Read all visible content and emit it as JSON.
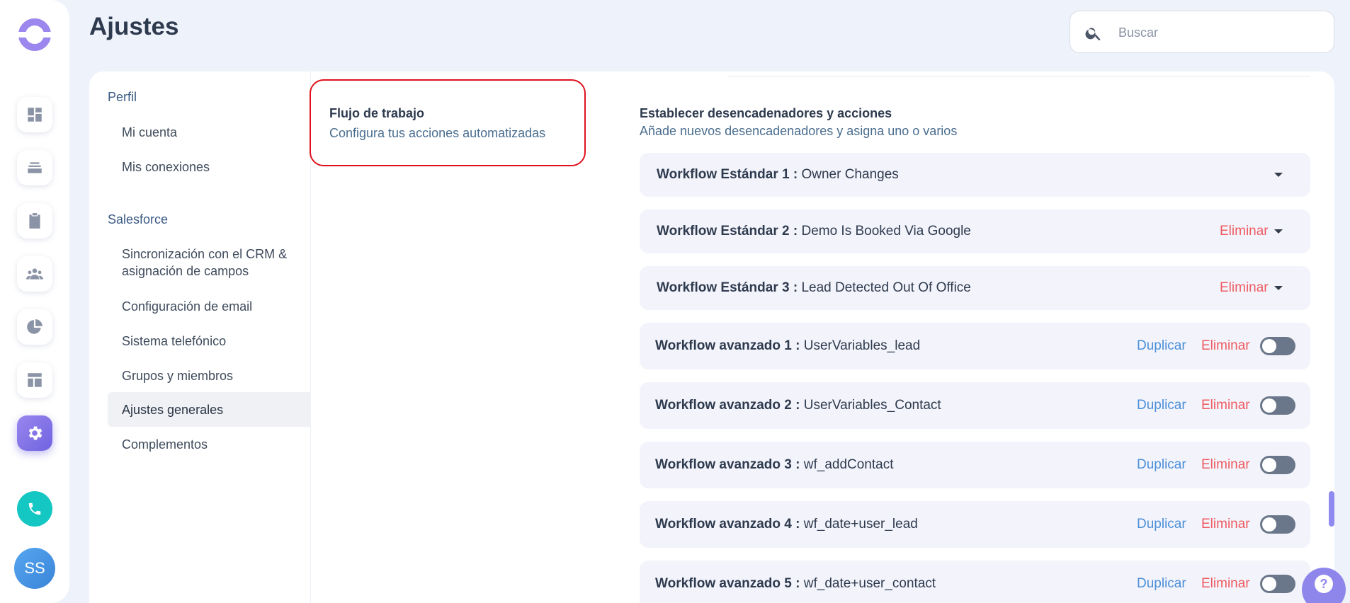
{
  "header": {
    "title": "Ajustes"
  },
  "search": {
    "placeholder": "Buscar"
  },
  "avatar": {
    "initials": "SS"
  },
  "help": {
    "glyph": "?"
  },
  "colors": {
    "accent": "#6f63e0",
    "danger": "#ee5a61",
    "link": "#4a8ed8",
    "highlight_border": "#e0111c"
  },
  "rail": {
    "items": [
      {
        "icon": "dashboard-icon",
        "active": false
      },
      {
        "icon": "inbox-icon",
        "active": false
      },
      {
        "icon": "clipboard-icon",
        "active": false
      },
      {
        "icon": "people-icon",
        "active": false
      },
      {
        "icon": "pie-chart-icon",
        "active": false
      },
      {
        "icon": "layout-icon",
        "active": false
      },
      {
        "icon": "gear-icon",
        "active": true
      }
    ]
  },
  "sidebar": {
    "sections": [
      {
        "heading": "Perfil",
        "items": [
          "Mi cuenta",
          "Mis conexiones"
        ]
      },
      {
        "heading": "Salesforce",
        "items": [
          "Sincronización con el CRM & asignación de campos",
          "Configuración de email",
          "Sistema telefónico",
          "Grupos y miembros",
          "Ajustes generales",
          "Complementos"
        ]
      }
    ],
    "active_item": "Ajustes generales"
  },
  "workflow_section": {
    "title": "Flujo de trabajo",
    "subtitle": "Configura tus acciones automatizadas"
  },
  "triggers": {
    "title": "Establecer desencadenadores y acciones",
    "subtitle": "Añade nuevos desencadenadores y asigna uno o varios"
  },
  "actions": {
    "duplicate": "Duplicar",
    "delete": "Eliminar"
  },
  "workflows": [
    {
      "prefix": "Workflow Estándar 1 :",
      "name": "Owner Changes",
      "type": "standard",
      "deletable": false
    },
    {
      "prefix": "Workflow Estándar 2 :",
      "name": "Demo Is Booked Via Google",
      "type": "standard",
      "deletable": true
    },
    {
      "prefix": "Workflow Estándar 3 :",
      "name": "Lead Detected Out Of Office",
      "type": "standard",
      "deletable": true
    },
    {
      "prefix": "Workflow avanzado 1 :",
      "name": "UserVariables_lead",
      "type": "advanced",
      "enabled": false
    },
    {
      "prefix": "Workflow avanzado 2 :",
      "name": "UserVariables_Contact",
      "type": "advanced",
      "enabled": false
    },
    {
      "prefix": "Workflow avanzado 3 :",
      "name": "wf_addContact",
      "type": "advanced",
      "enabled": false
    },
    {
      "prefix": "Workflow avanzado 4 :",
      "name": "wf_date+user_lead",
      "type": "advanced",
      "enabled": false
    },
    {
      "prefix": "Workflow avanzado 5 :",
      "name": "wf_date+user_contact",
      "type": "advanced",
      "enabled": false
    }
  ]
}
